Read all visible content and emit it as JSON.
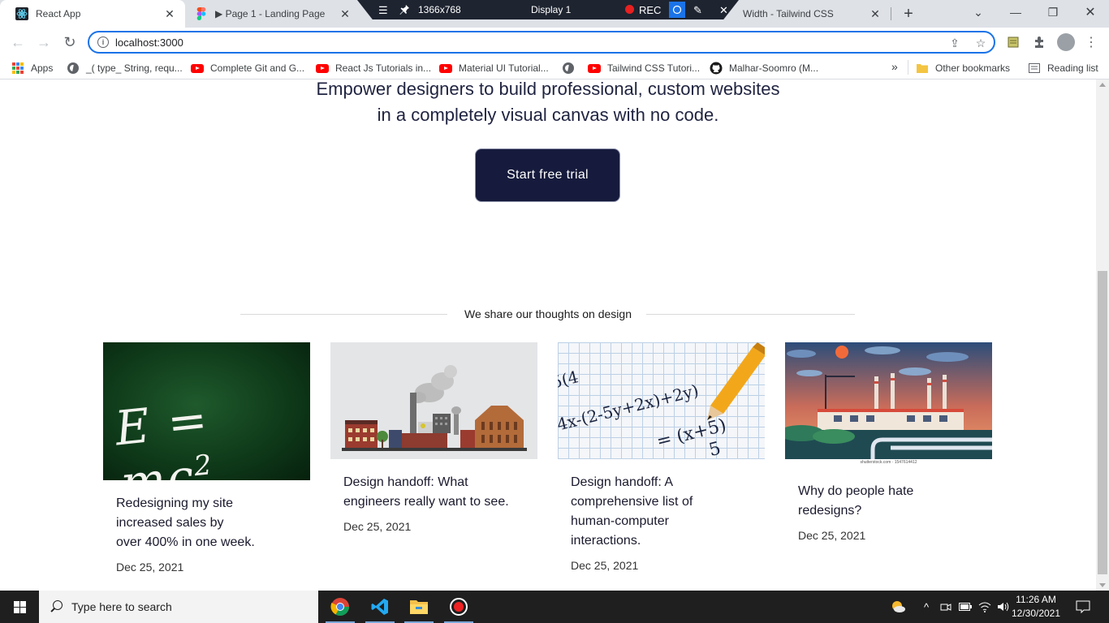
{
  "browser": {
    "tabs": [
      {
        "title": "React App",
        "active": true
      },
      {
        "title": "▶ Page 1 - Landing Page",
        "active": false
      },
      {
        "title": "Width - Tailwind CSS",
        "active": false
      }
    ],
    "recorder": {
      "resolution": "1366x768",
      "display": "Display 1",
      "rec_label": "REC"
    },
    "url": "localhost:3000",
    "bookmarks": [
      {
        "label": "Apps",
        "icon": "apps-grid-icon"
      },
      {
        "label": "_( type_ String, requ...",
        "icon": "globe-icon"
      },
      {
        "label": "Complete Git and G...",
        "icon": "youtube-icon"
      },
      {
        "label": "React Js Tutorials in...",
        "icon": "youtube-icon"
      },
      {
        "label": "Material UI Tutorial...",
        "icon": "youtube-icon"
      },
      {
        "label": "",
        "icon": "globe-icon"
      },
      {
        "label": "Tailwind CSS Tutori...",
        "icon": "youtube-icon"
      },
      {
        "label": "Malhar-Soomro (M...",
        "icon": "github-icon"
      }
    ],
    "bookmarks_overflow": "»",
    "other_bookmarks": "Other bookmarks",
    "reading_list": "Reading list"
  },
  "hero": {
    "line1": "Empower designers to build professional, custom websites",
    "line2": "in a completely visual canvas with no code.",
    "cta_label": "Start free trial"
  },
  "blog": {
    "section_title": "We share our thoughts on design",
    "posts": [
      {
        "title_lines": [
          "Redesigning my site",
          "increased sales by",
          "over 400% in one week."
        ],
        "date": "Dec 25, 2021",
        "image": "e-equals-mc2-chalkboard"
      },
      {
        "title_lines": [
          "Design handoff: What",
          "engineers really want to see."
        ],
        "date": "Dec 25, 2021",
        "image": "factory-illustration"
      },
      {
        "title_lines": [
          "Design handoff: A",
          "comprehensive list of",
          "human-computer",
          "interactions."
        ],
        "date": "Dec 25, 2021",
        "image": "math-pencil-paper"
      },
      {
        "title_lines": [
          "Why do people hate",
          "redesigns?"
        ],
        "date": "Dec 25, 2021",
        "image": "industrial-sunset-illustration",
        "image_caption": "shutterstock.com · 1547614412"
      }
    ],
    "chalk_text": "E = mc",
    "chalk_sup": "2",
    "math_text_1": "5(4",
    "math_text_2": "4x-(2-5y+2x)+2y)",
    "math_text_3": "= (x+5)",
    "math_text_4": "5"
  },
  "taskbar": {
    "search_placeholder": "Type here to search",
    "time": "11:26 AM",
    "date": "12/30/2021"
  },
  "colors": {
    "cta_bg": "#161b3d",
    "omnibox_border": "#1a73e8",
    "taskbar_bg": "#1f1f1f"
  }
}
